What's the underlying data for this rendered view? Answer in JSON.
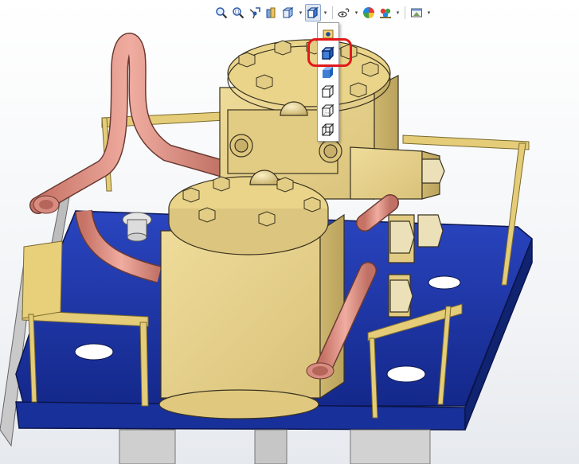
{
  "window": {
    "width": 727,
    "height": 583
  },
  "toolbar": {
    "items": [
      {
        "id": "zoom-to-fit",
        "icon": "zoom-to-fit-icon"
      },
      {
        "id": "zoom-to-area",
        "icon": "zoom-to-area-icon"
      },
      {
        "id": "previous-view",
        "icon": "previous-view-icon"
      },
      {
        "id": "section-view",
        "icon": "section-view-icon"
      },
      {
        "id": "view-orientation",
        "icon": "view-orientation-icon",
        "has_menu": true
      },
      {
        "id": "display-style",
        "icon": "display-style-icon",
        "has_menu": true,
        "active": true
      },
      {
        "id": "hide-show-items",
        "icon": "hide-show-items-icon",
        "has_menu": true
      },
      {
        "id": "edit-appearance",
        "icon": "edit-appearance-icon"
      },
      {
        "id": "apply-scene",
        "icon": "apply-scene-icon",
        "has_menu": true
      },
      {
        "id": "view-settings",
        "icon": "view-settings-icon",
        "has_menu": true
      }
    ],
    "caret_glyph": "▾"
  },
  "display_style_menu": {
    "items": [
      {
        "id": "shaded-with-edges",
        "icon": "shaded-with-edges-icon",
        "selected": true
      },
      {
        "id": "shaded",
        "icon": "shaded-icon"
      },
      {
        "id": "hidden-lines-removed",
        "icon": "hidden-lines-removed-icon"
      },
      {
        "id": "hidden-lines-visible",
        "icon": "hidden-lines-visible-icon"
      },
      {
        "id": "wireframe",
        "icon": "wireframe-icon"
      }
    ]
  },
  "colors": {
    "part_body": "#e8d48f",
    "part_edge": "#3a3320",
    "base_plate": "#1f37a8",
    "pipe": "#d88c80",
    "highlight": "#e11a1a",
    "frame": "#e0c878"
  }
}
